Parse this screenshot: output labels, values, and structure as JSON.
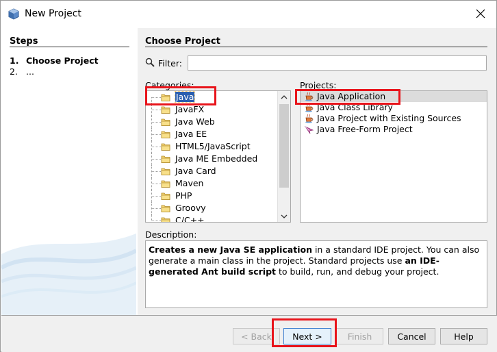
{
  "window": {
    "title": "New Project"
  },
  "steps": {
    "title": "Steps",
    "items": [
      {
        "num": "1.",
        "label": "Choose Project"
      },
      {
        "num": "2.",
        "label": "..."
      }
    ]
  },
  "content": {
    "title": "Choose Project",
    "filter_label": "Filter:",
    "filter_value": "",
    "categories_label": "Categories:",
    "projects_label": "Projects:",
    "categories": [
      {
        "label": "Java",
        "selected": true
      },
      {
        "label": "JavaFX"
      },
      {
        "label": "Java Web"
      },
      {
        "label": "Java EE"
      },
      {
        "label": "HTML5/JavaScript"
      },
      {
        "label": "Java ME Embedded"
      },
      {
        "label": "Java Card"
      },
      {
        "label": "Maven"
      },
      {
        "label": "PHP"
      },
      {
        "label": "Groovy"
      },
      {
        "label": "C/C++"
      }
    ],
    "projects": [
      {
        "label": "Java Application",
        "icon": "coffee-cup-icon",
        "selected": true
      },
      {
        "label": "Java Class Library",
        "icon": "coffee-cup-icon"
      },
      {
        "label": "Java Project with Existing Sources",
        "icon": "coffee-cup-icon"
      },
      {
        "label": "Java Free-Form Project",
        "icon": "free-form-icon"
      }
    ],
    "description_label": "Description:",
    "description": {
      "part1_bold": "Creates a new Java SE application",
      "part2": " in a standard IDE project. You can also generate a main class in the project. Standard projects use ",
      "part3_bold": "an IDE-generated Ant build script",
      "part4": " to build, run, and debug your project."
    }
  },
  "buttons": {
    "back": "< Back",
    "next": "Next >",
    "finish": "Finish",
    "cancel": "Cancel",
    "help": "Help"
  },
  "colors": {
    "selection": "#2a5fb0",
    "highlight_annotation": "#e8141b",
    "dialog_bg": "#f0f0f0"
  }
}
